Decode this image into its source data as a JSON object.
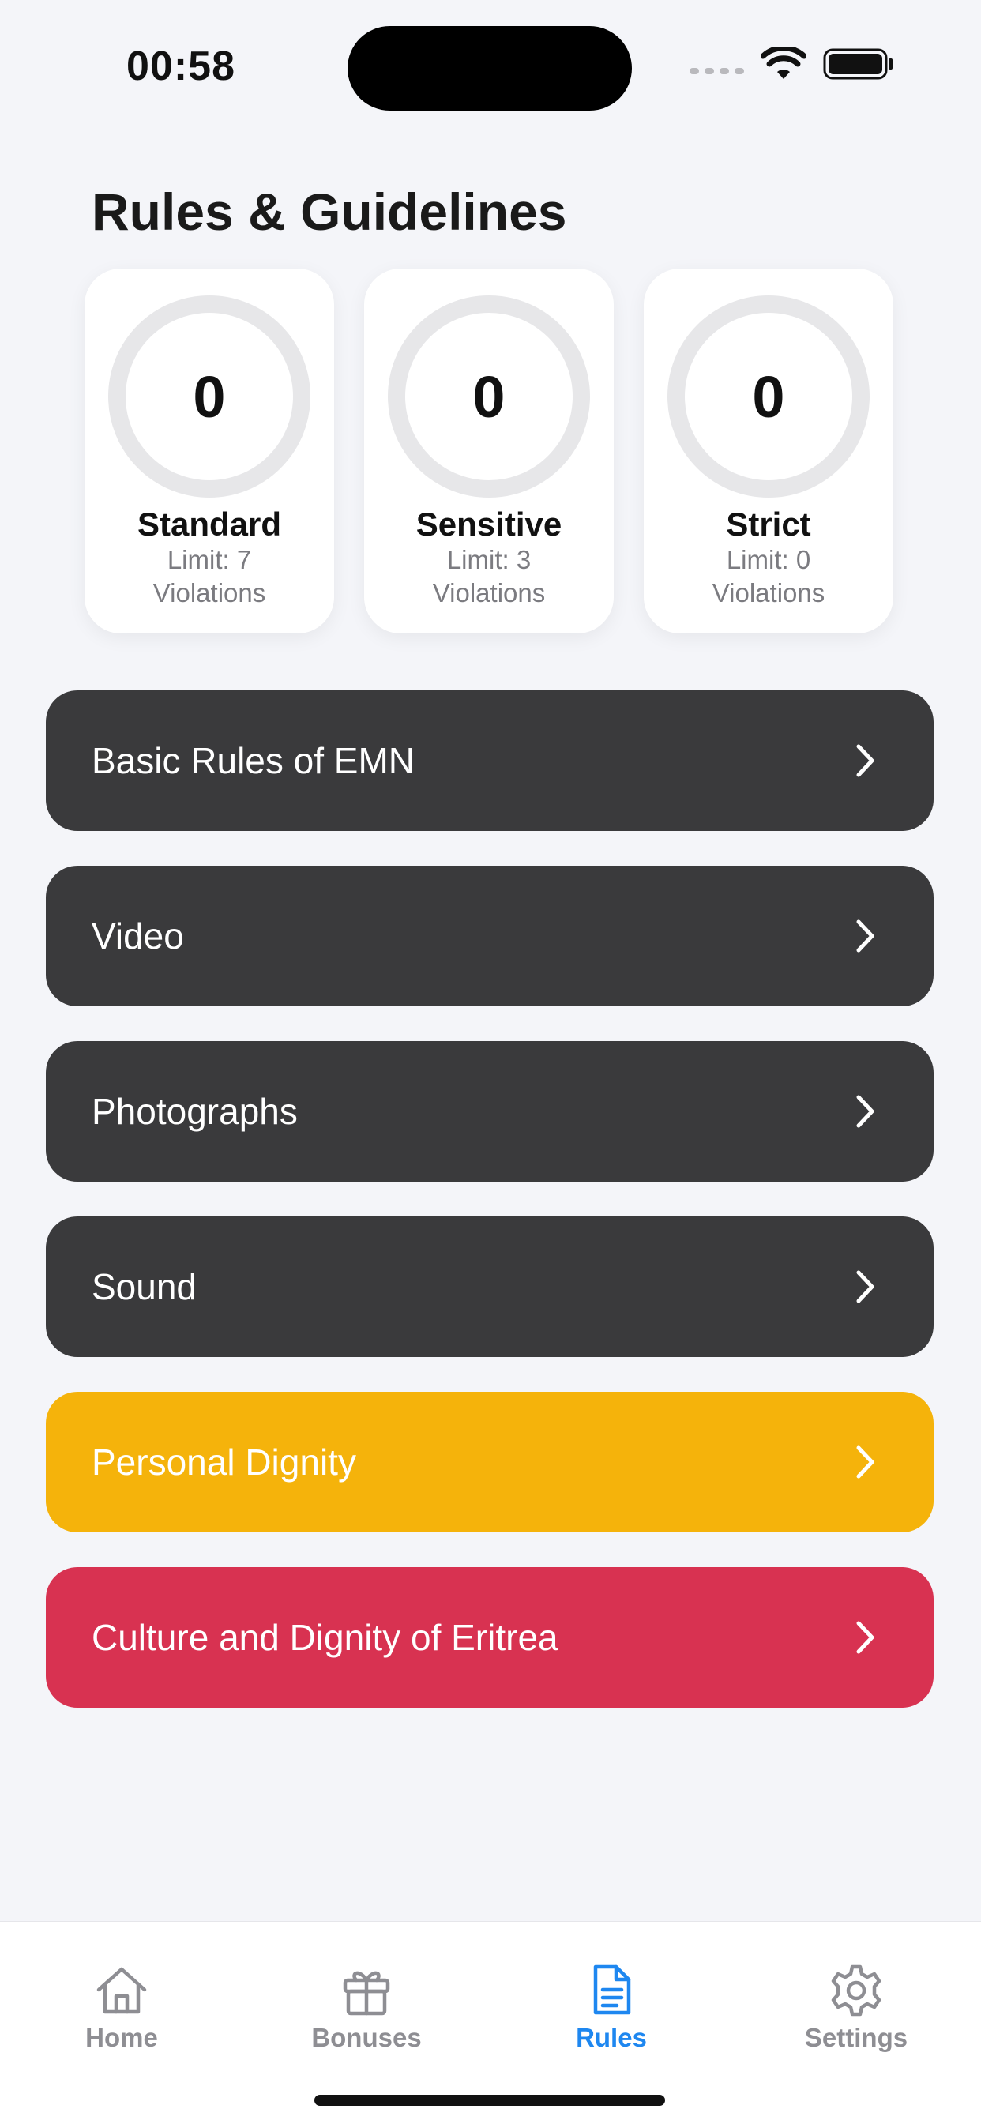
{
  "status_bar": {
    "time": "00:58"
  },
  "page": {
    "title": "Rules & Guidelines"
  },
  "limit_cards": [
    {
      "count": "0",
      "title": "Standard",
      "limit": "Limit: 7",
      "unit": "Violations"
    },
    {
      "count": "0",
      "title": "Sensitive",
      "limit": "Limit: 3",
      "unit": "Violations"
    },
    {
      "count": "0",
      "title": "Strict",
      "limit": "Limit: 0",
      "unit": "Violations"
    }
  ],
  "rules": [
    {
      "label": "Basic Rules of EMN",
      "color": "#3a3a3c"
    },
    {
      "label": "Video",
      "color": "#3a3a3c"
    },
    {
      "label": "Photographs",
      "color": "#3a3a3c"
    },
    {
      "label": "Sound",
      "color": "#3a3a3c"
    },
    {
      "label": "Personal Dignity",
      "color": "#f5b30b"
    },
    {
      "label": "Culture and Dignity of Eritrea",
      "color": "#d83251"
    }
  ],
  "tab_bar": {
    "tabs": [
      {
        "label": "Home",
        "icon": "house-icon"
      },
      {
        "label": "Bonuses",
        "icon": "gift-icon"
      },
      {
        "label": "Rules",
        "icon": "document-icon",
        "active": true
      },
      {
        "label": "Settings",
        "icon": "gear-icon"
      }
    ],
    "active_color": "#1e87f0",
    "inactive_color": "#8e8e93"
  }
}
